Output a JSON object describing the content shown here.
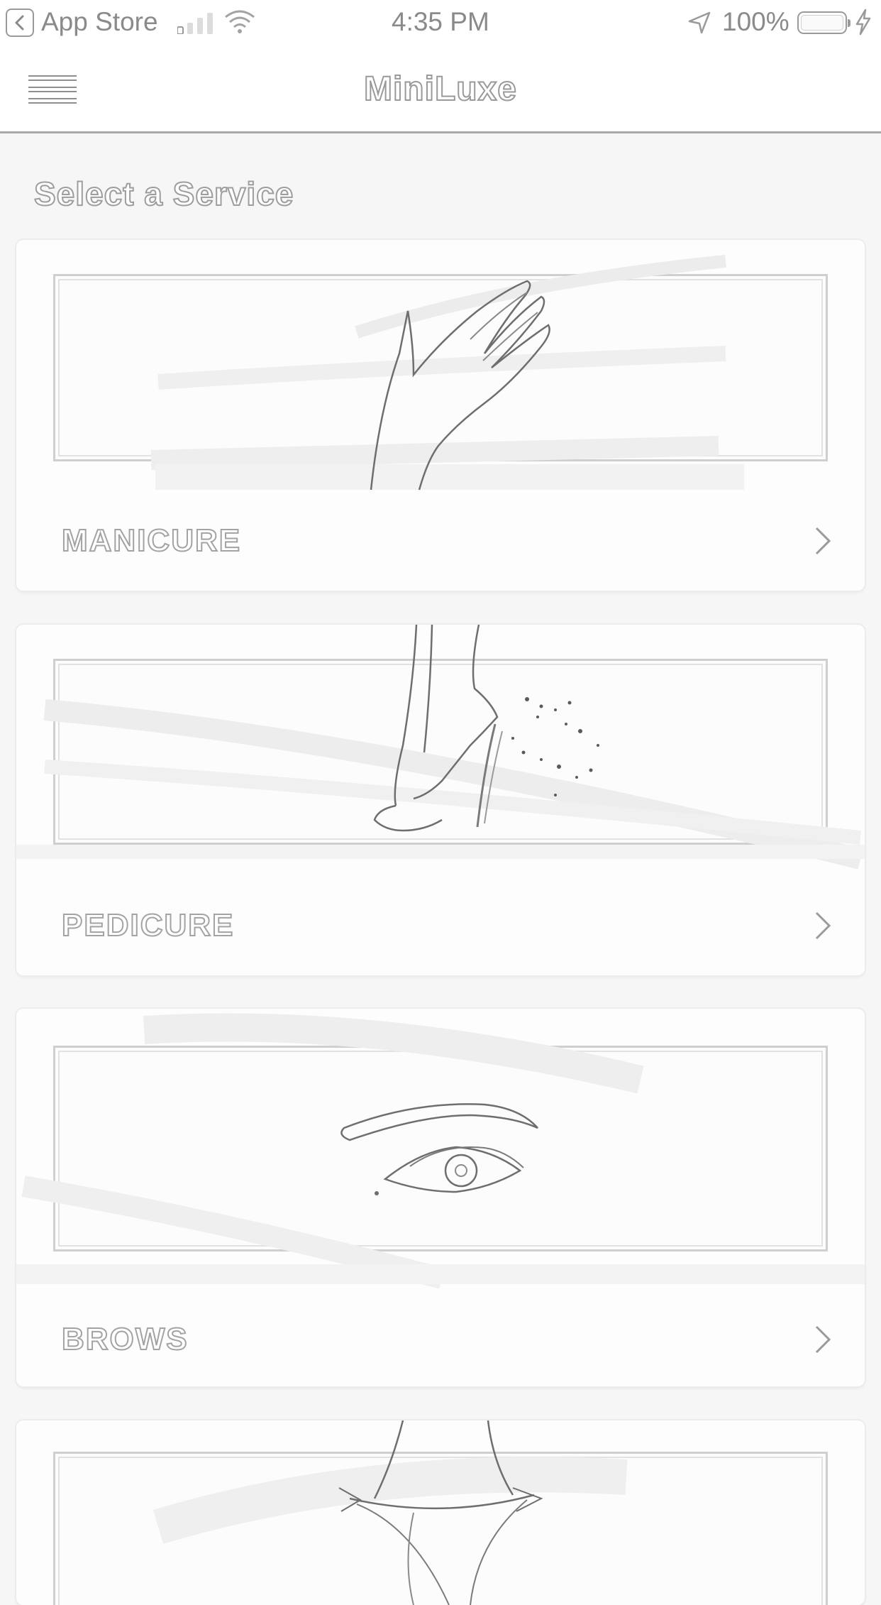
{
  "status_bar": {
    "back_label": "App Store",
    "time": "4:35 PM",
    "battery": "100%"
  },
  "nav": {
    "title": "MiniLuxe",
    "menu_icon": "hamburger-menu-icon"
  },
  "page": {
    "section_title": "Select a Service"
  },
  "services": [
    {
      "label": "MANICURE",
      "art_icon": "hand-illustration-icon"
    },
    {
      "label": "PEDICURE",
      "art_icon": "foot-heel-illustration-icon"
    },
    {
      "label": "BROWS",
      "art_icon": "eye-brow-illustration-icon"
    },
    {
      "label": "",
      "art_icon": "bikini-illustration-icon"
    }
  ],
  "colors": {
    "background": "#f6f6f6",
    "card": "#fdfdfd",
    "text_outline": "#a3a3a3"
  }
}
